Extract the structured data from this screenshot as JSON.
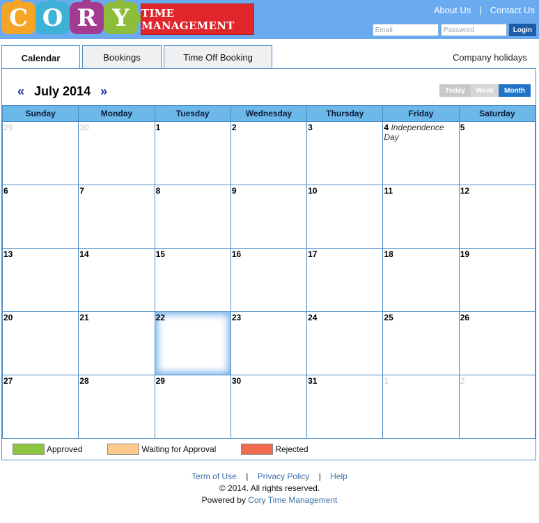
{
  "header": {
    "logo_letters": [
      "C",
      "O",
      "R",
      "Y"
    ],
    "brand": "TIME MANAGEMENT",
    "links": [
      "About Us",
      "Contact Us"
    ],
    "link_separator": "|",
    "login": {
      "email_placeholder": "Email",
      "password_placeholder": "Password",
      "button": "Login"
    }
  },
  "tabs": [
    "Calendar",
    "Bookings",
    "Time Off Booking"
  ],
  "company_holidays": "Company holidays",
  "calendar": {
    "prev": "«",
    "next": "»",
    "month_title": "July 2014",
    "views": [
      "Today",
      "Week",
      "Month"
    ],
    "weekdays": [
      "Sunday",
      "Monday",
      "Tuesday",
      "Wednesday",
      "Thursday",
      "Friday",
      "Saturday"
    ],
    "weeks": [
      [
        {
          "d": "29",
          "o": true
        },
        {
          "d": "30",
          "o": true
        },
        {
          "d": "1"
        },
        {
          "d": "2"
        },
        {
          "d": "3"
        },
        {
          "d": "4",
          "event": "Independence Day"
        },
        {
          "d": "5"
        }
      ],
      [
        {
          "d": "6"
        },
        {
          "d": "7"
        },
        {
          "d": "8"
        },
        {
          "d": "9"
        },
        {
          "d": "10"
        },
        {
          "d": "11"
        },
        {
          "d": "12"
        }
      ],
      [
        {
          "d": "13"
        },
        {
          "d": "14"
        },
        {
          "d": "15"
        },
        {
          "d": "16"
        },
        {
          "d": "17"
        },
        {
          "d": "18"
        },
        {
          "d": "19"
        }
      ],
      [
        {
          "d": "20"
        },
        {
          "d": "21"
        },
        {
          "d": "22",
          "today": true
        },
        {
          "d": "23"
        },
        {
          "d": "24"
        },
        {
          "d": "25"
        },
        {
          "d": "26"
        }
      ],
      [
        {
          "d": "27"
        },
        {
          "d": "28"
        },
        {
          "d": "29"
        },
        {
          "d": "30"
        },
        {
          "d": "31"
        },
        {
          "d": "1",
          "o": true
        },
        {
          "d": "2",
          "o": true
        }
      ]
    ]
  },
  "legend": [
    {
      "label": "Approved",
      "color": "#8cc63f"
    },
    {
      "label": "Waiting for Approval",
      "color": "#fdc98c"
    },
    {
      "label": "Rejected",
      "color": "#f26b4f"
    }
  ],
  "footer": {
    "links": [
      "Term of Use",
      "Privacy Policy",
      "Help"
    ],
    "separator": "|",
    "copyright": "© 2014. All rights reserved.",
    "powered_prefix": "Powered by",
    "powered_link": "Cory Time Management"
  }
}
